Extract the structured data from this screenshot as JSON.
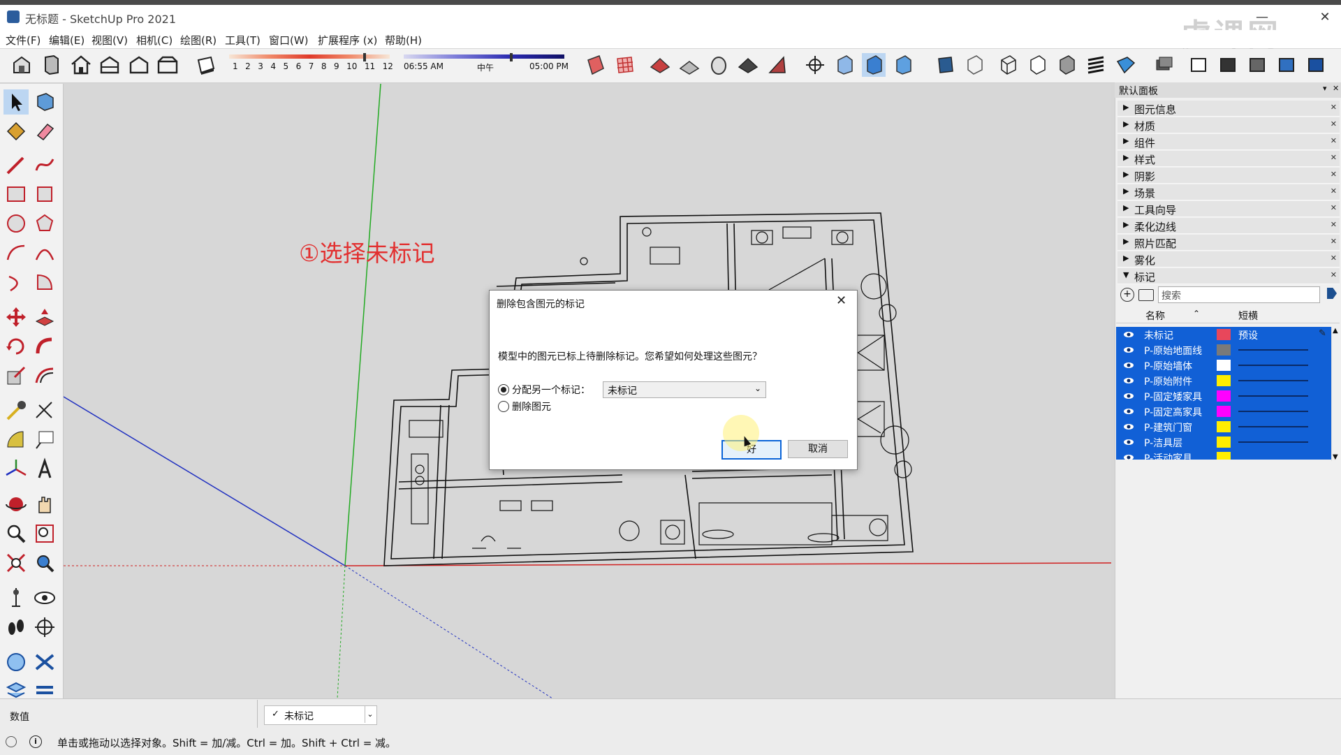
{
  "window": {
    "title": "无标题 - SketchUp Pro 2021",
    "watermark": "虎课网"
  },
  "menu": [
    "文件(F)",
    "编辑(E)",
    "视图(V)",
    "相机(C)",
    "绘图(R)",
    "工具(T)",
    "窗口(W)",
    "扩展程序 (x)",
    "帮助(H)"
  ],
  "shadow": {
    "months": [
      "1",
      "2",
      "3",
      "4",
      "5",
      "6",
      "7",
      "8",
      "9",
      "10",
      "11",
      "12"
    ],
    "time_start": "06:55 AM",
    "noon": "中午",
    "time_end": "05:00 PM"
  },
  "annotation": "①选择未标记",
  "dialog": {
    "title": "删除包含图元的标记",
    "message": "模型中的图元已标上待删除标记。您希望如何处理这些图元？",
    "option_assign": "分配另一个标记：",
    "option_delete": "删除图元",
    "selected_tag": "未标记",
    "ok": "好",
    "cancel": "取消"
  },
  "panel": {
    "title": "默认面板",
    "trays": [
      "图元信息",
      "材质",
      "组件",
      "样式",
      "阴影",
      "场景",
      "工具向导",
      "柔化边线",
      "照片匹配",
      "雾化",
      "标记"
    ],
    "search_placeholder": "搜索",
    "col_name": "名称",
    "col_dash": "短横",
    "tags": [
      {
        "name": "未标记",
        "color": "#e8475b",
        "dash": "预设"
      },
      {
        "name": "P-原始地面线",
        "color": "#7a7a7a",
        "dash": ""
      },
      {
        "name": "P-原始墙体",
        "color": "#ffffff",
        "dash": ""
      },
      {
        "name": "P-原始附件",
        "color": "#ffee00",
        "dash": ""
      },
      {
        "name": "P-固定矮家具",
        "color": "#ff00ff",
        "dash": ""
      },
      {
        "name": "P-固定高家具",
        "color": "#ff00ff",
        "dash": ""
      },
      {
        "name": "P-建筑门窗",
        "color": "#ffee00",
        "dash": ""
      },
      {
        "name": "P-洁具层",
        "color": "#ffee00",
        "dash": ""
      },
      {
        "name": "P-活动家具",
        "color": "#ffee00",
        "dash": ""
      }
    ]
  },
  "status": {
    "measure_label": "数值",
    "active_tag": "未标记",
    "hint": "单击或拖动以选择对象。Shift = 加/减。Ctrl = 加。Shift + Ctrl = 减。"
  }
}
